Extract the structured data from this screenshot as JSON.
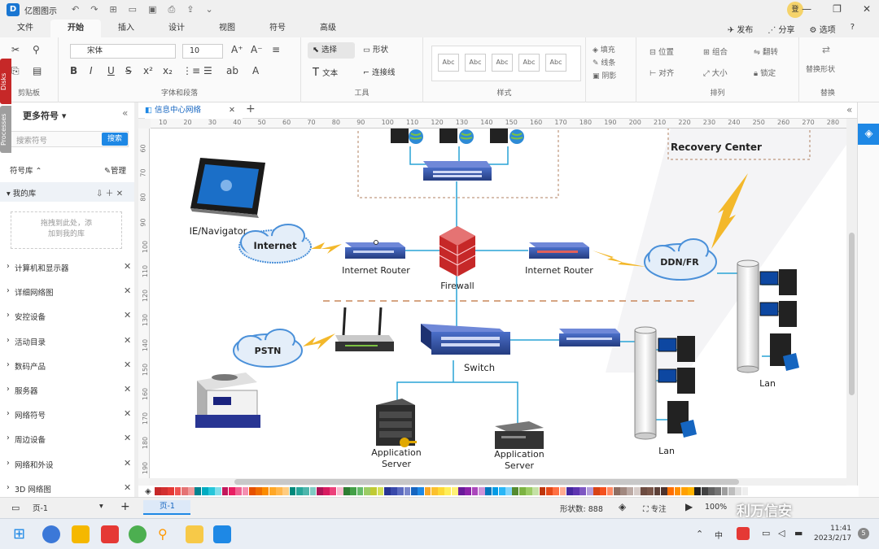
{
  "app": {
    "title": "亿图图示",
    "avatar_text": "登"
  },
  "window_controls": {
    "minimize": "—",
    "restore": "❐",
    "close": "✕"
  },
  "menu": {
    "tabs": [
      "文件",
      "开始",
      "插入",
      "设计",
      "视图",
      "符号",
      "高级"
    ],
    "active": "开始",
    "right": [
      "发布",
      "分享",
      "选项"
    ]
  },
  "ribbon": {
    "font_name": "宋体",
    "font_size": "10",
    "group_labels": {
      "clipboard": "剪贴板",
      "font": "字体和段落",
      "tools": "工具",
      "styles": "样式",
      "arrange": "排列",
      "replace": "替换"
    },
    "tools": {
      "select": "选择",
      "shape": "形状",
      "text": "文本",
      "connector": "连接线"
    },
    "style_boxes": [
      "Abc",
      "Abc",
      "Abc",
      "Abc",
      "Abc"
    ],
    "fill": "填充",
    "line": "线条",
    "shadow": "阴影",
    "position": "位置",
    "align": "对齐",
    "group": "组合",
    "size": "大小",
    "flip": "翻转",
    "lock": "锁定",
    "replace_shape": "替换形状"
  },
  "left_panel": {
    "title": "更多符号",
    "search_placeholder": "搜索符号",
    "search_button": "搜索",
    "library_label": "符号库",
    "manage": "管理",
    "my_library": "我的库",
    "drop_hint_1": "拖拽到此处，添",
    "drop_hint_2": "加到我的库",
    "categories": [
      "计算机和显示器",
      "详细网络图",
      "安控设备",
      "活动目录",
      "数码产品",
      "服务器",
      "网络符号",
      "周边设备",
      "网络和外设",
      "3D 网络图"
    ],
    "vertical_tabs": [
      "Disks",
      "Processes"
    ]
  },
  "document": {
    "tab": "信息中心网络"
  },
  "ruler": {
    "h_ticks": [
      "10",
      "20",
      "30",
      "40",
      "50",
      "60",
      "70",
      "80",
      "90",
      "100",
      "110",
      "120",
      "130",
      "140",
      "150",
      "160",
      "170",
      "180",
      "190",
      "200",
      "210",
      "220",
      "230",
      "240",
      "250",
      "260",
      "270",
      "280"
    ],
    "v_ticks": [
      "60",
      "70",
      "80",
      "90",
      "100",
      "110",
      "120",
      "130",
      "140",
      "150",
      "160",
      "170",
      "180",
      "190"
    ]
  },
  "diagram": {
    "labels": {
      "recovery": "Recovery Center",
      "ie": "IE/Navigator",
      "internet": "Internet",
      "router1": "Internet Router",
      "firewall": "Firewall",
      "router2": "Internet Router",
      "ddn": "DDN/FR",
      "pstn": "PSTN",
      "switch": "Switch",
      "app1_line1": "Application",
      "app1_line2": "Server",
      "app2_line1": "Application",
      "app2_line2": "Server",
      "lan1": "Lan",
      "lan2": "Lan"
    },
    "colors": {
      "line": "#29a3d6",
      "lightning": "#f3b82b",
      "device": "#2f4f9e",
      "firewall": "#d32f2f",
      "cloud": "#4a90d9"
    }
  },
  "status": {
    "page_selector": "页-1",
    "page_tab": "页-1",
    "shape_count_label": "形状数:",
    "shape_count": "888",
    "focus": "专注",
    "zoom": "100%"
  },
  "watermark": "利万信安",
  "taskbar": {
    "ime": "中",
    "time": "11:41",
    "date": "2023/2/17",
    "notif": "5"
  },
  "palette": [
    "#c62828",
    "#d32f2f",
    "#e53935",
    "#ef5350",
    "#e57373",
    "#ef9a9a",
    "#00838f",
    "#00acc1",
    "#26c6da",
    "#80deea",
    "#c2185b",
    "#e91e63",
    "#f06292",
    "#f48fb1",
    "#e65100",
    "#ef6c00",
    "#fb8c00",
    "#ffa726",
    "#ffb74d",
    "#ffcc80",
    "#00897b",
    "#26a69a",
    "#4db6ac",
    "#80cbc4",
    "#ad1457",
    "#d81b60",
    "#ec407a",
    "#f8bbd0",
    "#2e7d32",
    "#43a047",
    "#66bb6a",
    "#9ccc65",
    "#c0ca33",
    "#d4e157",
    "#283593",
    "#3949ab",
    "#5c6bc0",
    "#7986cb",
    "#1565c0",
    "#1e88e5",
    "#f9a825",
    "#fbc02d",
    "#fdd835",
    "#ffee58",
    "#fff176",
    "#6a1b9a",
    "#8e24aa",
    "#ab47bc",
    "#ce93d8",
    "#0277bd",
    "#039be5",
    "#29b6f6",
    "#81d4fa",
    "#558b2f",
    "#7cb342",
    "#9ccc65",
    "#c5e1a5",
    "#bf360c",
    "#e64a19",
    "#ff7043",
    "#ffab91",
    "#4527a0",
    "#5e35b1",
    "#7e57c2",
    "#b39ddb",
    "#d84315",
    "#f4511e",
    "#ff8a65",
    "#8d6e63",
    "#a1887f",
    "#bcaaa4",
    "#d7ccc8",
    "#6d4c41",
    "#795548",
    "#5d4037",
    "#4e342e",
    "#ff6f00",
    "#ff8f00",
    "#ffa000",
    "#ffb300",
    "#212121",
    "#424242",
    "#616161",
    "#757575",
    "#9e9e9e",
    "#bdbdbd",
    "#e0e0e0",
    "#eeeeee"
  ]
}
